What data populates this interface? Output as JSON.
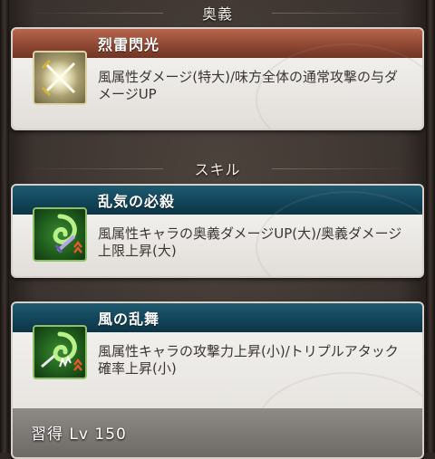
{
  "ougi_section": {
    "title": "奥義"
  },
  "ougi": {
    "name": "烈雷閃光",
    "description": "風属性ダメージ(特大)/味方全体の通常攻撃の与ダメージUP",
    "icon": "crossed-swords-icon"
  },
  "skill_section": {
    "title": "スキル"
  },
  "skills": [
    {
      "name": "乱気の必殺",
      "description": "風属性キャラの奥義ダメージUP(大)/奥義ダメージ上限上昇(大)",
      "icon": "wind-sword-icon"
    },
    {
      "name": "風の乱舞",
      "description": "風属性キャラの攻撃力上昇(小)/トリプルアタック確率上昇(小)",
      "icon": "wind-multi-attack-icon",
      "learn_label": "習得 Lv 150"
    }
  ],
  "colors": {
    "ougi_header": "#8f4833",
    "skill_header": "#12455a",
    "card_body": "#e9e7e3",
    "text": "#3a3633"
  }
}
